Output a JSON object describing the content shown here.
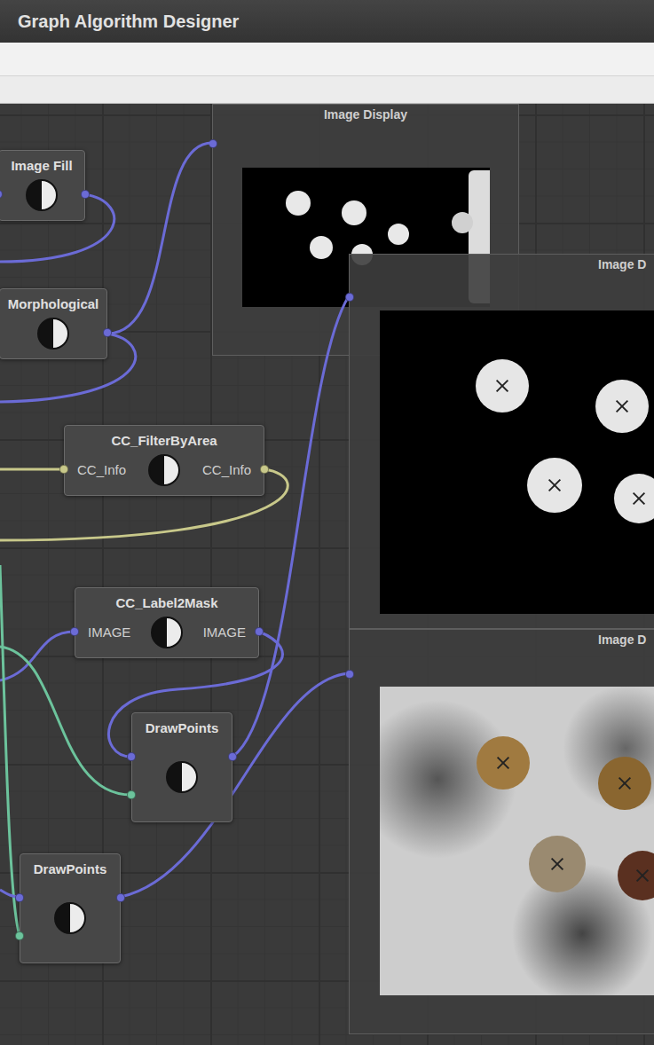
{
  "window": {
    "title": "Graph Algorithm Designer"
  },
  "nodes": [
    {
      "title": "Image Fill",
      "ports": [
        {
          "kind": "in",
          "color": "#6b6bd6"
        },
        {
          "kind": "out",
          "color": "#6b6bd6"
        }
      ]
    },
    {
      "title": "Morphological",
      "ports": [
        {
          "kind": "out",
          "color": "#6b6bd6"
        }
      ]
    },
    {
      "title": "CC_FilterByArea",
      "ports": [
        {
          "kind": "in",
          "label": "CC_Info",
          "color": "#c8c88a"
        },
        {
          "kind": "out",
          "label": "CC_Info",
          "color": "#c8c88a"
        }
      ]
    },
    {
      "title": "CC_Label2Mask",
      "ports": [
        {
          "kind": "in",
          "label": "IMAGE",
          "color": "#6b6bd6"
        },
        {
          "kind": "out",
          "label": "IMAGE",
          "color": "#6b6bd6"
        }
      ]
    },
    {
      "title": "DrawPoints",
      "ports": [
        {
          "kind": "in",
          "color": "#6b6bd6"
        },
        {
          "kind": "in",
          "color": "#6cc39c"
        },
        {
          "kind": "out",
          "color": "#6b6bd6"
        }
      ]
    },
    {
      "title": "DrawPoints",
      "ports": [
        {
          "kind": "in",
          "color": "#6b6bd6"
        },
        {
          "kind": "in",
          "color": "#6cc39c"
        },
        {
          "kind": "out",
          "color": "#6b6bd6"
        }
      ]
    }
  ],
  "displays": [
    {
      "title": "Image Display"
    },
    {
      "title": "Image D"
    },
    {
      "title": "Image D"
    }
  ]
}
